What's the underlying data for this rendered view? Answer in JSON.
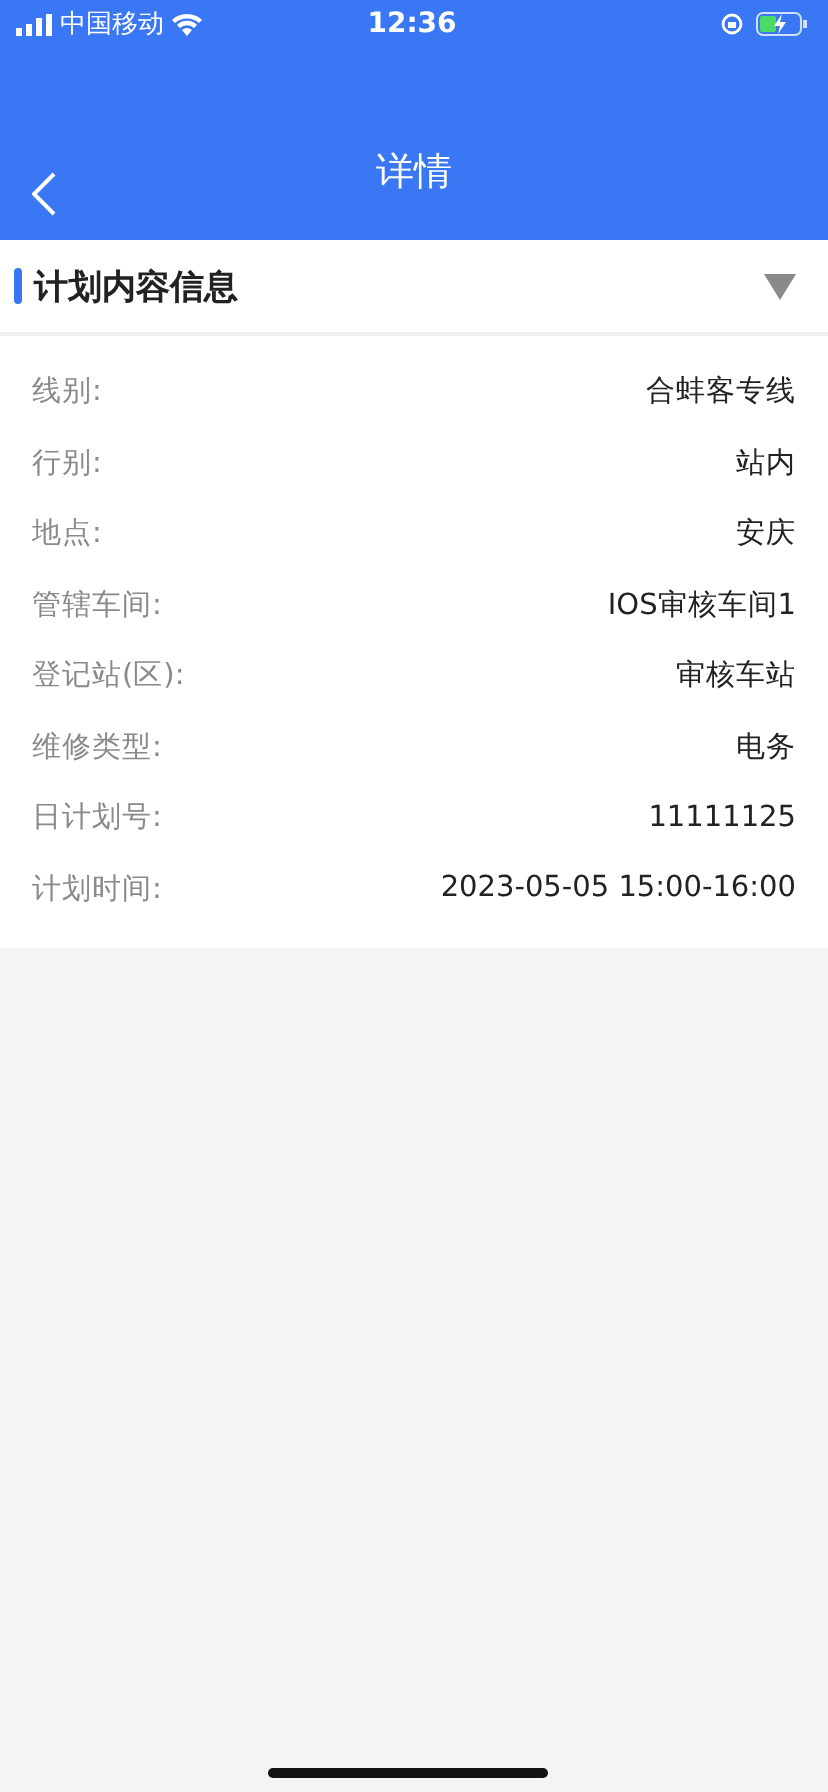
{
  "status_bar": {
    "carrier": "中国移动",
    "time": "12:36"
  },
  "nav": {
    "title": "详情"
  },
  "section": {
    "title": "计划内容信息",
    "rows": [
      {
        "label": "线别:",
        "value": "合蚌客专线"
      },
      {
        "label": "行别:",
        "value": "站内"
      },
      {
        "label": "地点:",
        "value": "安庆"
      },
      {
        "label": "管辖车间:",
        "value": "IOS审核车间1"
      },
      {
        "label": "登记站(区):",
        "value": "审核车站"
      },
      {
        "label": "维修类型:",
        "value": "电务"
      },
      {
        "label": "日计划号:",
        "value": "11111125"
      },
      {
        "label": "计划时间:",
        "value": "2023-05-05 15:00-16:00"
      }
    ]
  }
}
